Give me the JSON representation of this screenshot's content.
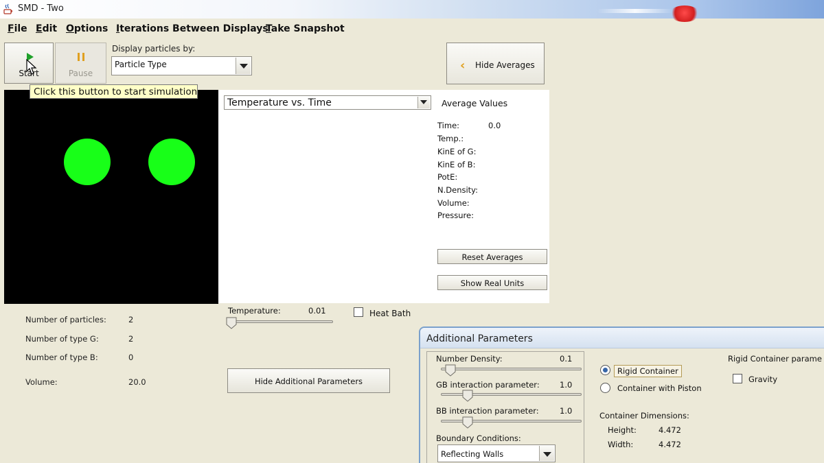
{
  "window": {
    "title": "SMD - Two"
  },
  "menu": [
    "File",
    "Edit",
    "Options",
    "Iterations Between Displays",
    "Take Snapshot"
  ],
  "toolbar": {
    "start_label": "Start",
    "pause_label": "Pause",
    "display_label": "Display particles by:",
    "display_value": "Particle Type",
    "hide_averages_label": "Hide Averages"
  },
  "tooltip": "Click this button to start simulation",
  "simulation": {
    "particle_color": "#18ff18",
    "background": "#000000"
  },
  "graph": {
    "selected": "Temperature vs. Time"
  },
  "averages": {
    "title": "Average Values",
    "rows": [
      {
        "label": "Time:",
        "value": "0.0"
      },
      {
        "label": "Temp.:",
        "value": ""
      },
      {
        "label": "KinE of G:",
        "value": ""
      },
      {
        "label": "KinE of B:",
        "value": ""
      },
      {
        "label": "PotE:",
        "value": ""
      },
      {
        "label": "N.Density:",
        "value": ""
      },
      {
        "label": "Volume:",
        "value": ""
      },
      {
        "label": "Pressure:",
        "value": ""
      }
    ],
    "reset_label": "Reset Averages",
    "real_units_label": "Show Real Units"
  },
  "stats": [
    {
      "label": "Number of particles:",
      "value": "2"
    },
    {
      "label": "Number of type G:",
      "value": "2"
    },
    {
      "label": "Number of type B:",
      "value": "0"
    },
    {
      "label": "Volume:",
      "value": "20.0"
    }
  ],
  "temperature": {
    "label": "Temperature:",
    "value": "0.01",
    "slider_fraction": 0.02
  },
  "heat_bath": {
    "label": "Heat Bath",
    "checked": false
  },
  "hide_additional_label": "Hide Additional Parameters",
  "additional": {
    "title": "Additional Parameters",
    "number_density": {
      "label": "Number Density:",
      "value": "0.1",
      "slider_fraction": 0.07
    },
    "gb": {
      "label": "GB interaction parameter:",
      "value": "1.0",
      "slider_fraction": 0.19
    },
    "bb": {
      "label": "BB interaction parameter:",
      "value": "1.0",
      "slider_fraction": 0.19
    },
    "boundary_label": "Boundary Conditions:",
    "boundary_value": "Reflecting Walls",
    "rigid_label": "Rigid Container",
    "piston_label": "Container with Piston",
    "selected_container": "rigid",
    "dims_label": "Container Dimensions:",
    "height_label": "Height:",
    "height_value": "4.472",
    "width_label": "Width:",
    "width_value": "4.472",
    "rigid_params_label": "Rigid Container parame",
    "gravity_label": "Gravity",
    "gravity_checked": false
  }
}
